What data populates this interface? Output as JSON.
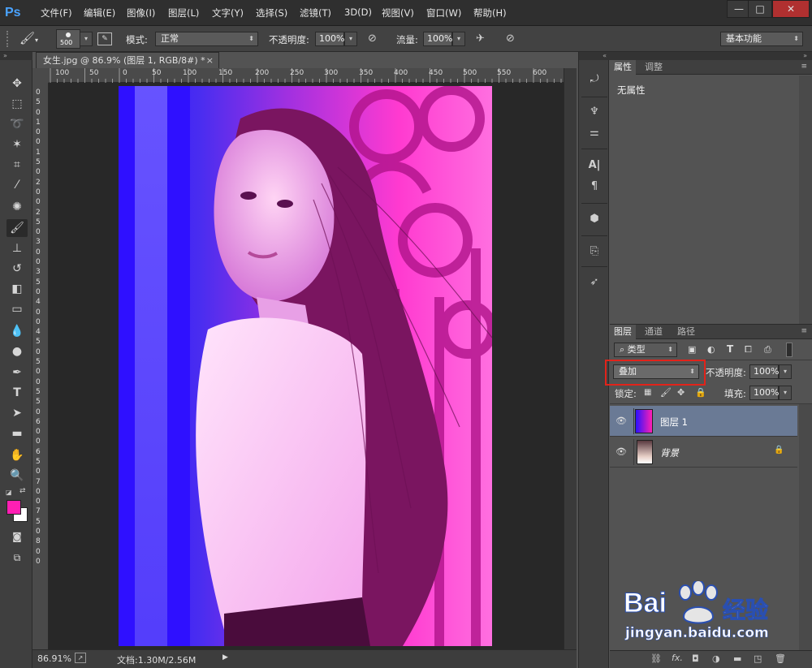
{
  "menubar": {
    "logo": "Ps",
    "items": [
      "文件(F)",
      "编辑(E)",
      "图像(I)",
      "图层(L)",
      "文字(Y)",
      "选择(S)",
      "滤镜(T)",
      "3D(D)",
      "视图(V)",
      "窗口(W)",
      "帮助(H)"
    ],
    "window_controls": [
      "—",
      "□",
      "✕"
    ]
  },
  "options": {
    "brush_size": "500",
    "mode_label": "模式:",
    "mode_value": "正常",
    "opacity_label": "不透明度:",
    "opacity_value": "100%",
    "flow_label": "流量:",
    "flow_value": "100%",
    "workspace": "基本功能"
  },
  "document": {
    "tab_title": "女生.jpg @ 86.9% (图层 1, RGB/8#) *",
    "tab_close": "×",
    "ruler_top": [
      "100",
      "50",
      "0",
      "50",
      "100",
      "150",
      "200",
      "250",
      "300",
      "350",
      "400",
      "450",
      "500",
      "550",
      "600"
    ],
    "ruler_left": [
      "0",
      "5",
      "0",
      "1",
      "0",
      "0",
      "1",
      "5",
      "0",
      "2",
      "0",
      "0",
      "2",
      "5",
      "0",
      "3",
      "0",
      "0",
      "3",
      "5",
      "0",
      "4",
      "0",
      "0",
      "4",
      "5",
      "0",
      "5",
      "0",
      "0",
      "5",
      "5",
      "0",
      "6",
      "0",
      "0",
      "6",
      "5",
      "0",
      "7",
      "0",
      "0",
      "7",
      "5",
      "0",
      "8",
      "0",
      "0"
    ],
    "zoom": "86.91%",
    "doc_info": "文档:1.30M/2.56M"
  },
  "properties": {
    "tabs": [
      "属性",
      "调整"
    ],
    "content": "无属性"
  },
  "layers": {
    "tabs": [
      "图层",
      "通道",
      "路径"
    ],
    "filter_label": "类型",
    "blend_mode": "叠加",
    "opacity_label": "不透明度:",
    "opacity_value": "100%",
    "lock_label": "锁定:",
    "fill_label": "填充:",
    "fill_value": "100%",
    "rows": [
      {
        "name": "图层 1",
        "selected": true
      },
      {
        "name": "背景",
        "selected": false
      }
    ]
  },
  "watermark": {
    "brand": "Bai",
    "brand2": "经验",
    "url": "jingyan.baidu.com"
  },
  "colors": {
    "foreground": "#ff1fb4",
    "background": "#ffffff",
    "highlight": "#e2231a",
    "selected_layer": "#6a7a95"
  }
}
